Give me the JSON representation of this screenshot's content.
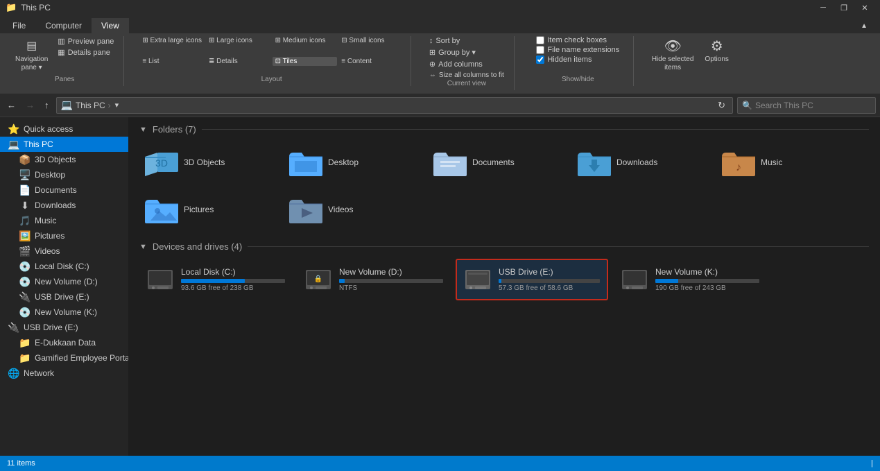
{
  "titlebar": {
    "title": "This PC",
    "minimize": "─",
    "restore": "❐",
    "close": "✕"
  },
  "ribbon": {
    "tabs": [
      "File",
      "Computer",
      "View"
    ],
    "active_tab": "View",
    "groups": {
      "panes": {
        "label": "Panes",
        "buttons": [
          {
            "id": "nav-pane",
            "icon": "▤",
            "label": "Navigation\npane ▾"
          },
          {
            "id": "preview-pane",
            "icon": "▥",
            "label": "Preview pane"
          },
          {
            "id": "details-pane",
            "icon": "▦",
            "label": "Details pane"
          }
        ]
      },
      "layout": {
        "label": "Layout",
        "buttons": [
          {
            "id": "extra-large",
            "label": "Extra large icons"
          },
          {
            "id": "large",
            "label": "Large icons"
          },
          {
            "id": "medium",
            "label": "Medium icons"
          },
          {
            "id": "small",
            "label": "Small icons"
          },
          {
            "id": "list",
            "label": "List"
          },
          {
            "id": "details",
            "label": "Details"
          },
          {
            "id": "tiles",
            "label": "Tiles",
            "active": true
          },
          {
            "id": "content",
            "label": "Content"
          }
        ]
      },
      "current_view": {
        "label": "Current view",
        "buttons": [
          {
            "id": "sort-by",
            "label": "Sort by"
          },
          {
            "id": "group-by",
            "label": "Group by ▾"
          },
          {
            "id": "add-columns",
            "label": "Add columns"
          },
          {
            "id": "size-all",
            "label": "Size all columns to fit"
          }
        ]
      },
      "show_hide": {
        "label": "Show/hide",
        "checkboxes": [
          {
            "id": "item-check",
            "label": "Item check boxes",
            "checked": false
          },
          {
            "id": "file-ext",
            "label": "File name extensions",
            "checked": false
          },
          {
            "id": "hidden",
            "label": "Hidden items",
            "checked": true
          }
        ],
        "buttons": [
          {
            "id": "hide-selected",
            "label": "Hide selected\nitems"
          }
        ]
      },
      "options": {
        "label": "",
        "buttons": [
          {
            "id": "options",
            "label": "Options"
          }
        ]
      }
    }
  },
  "addressbar": {
    "back_disabled": false,
    "forward_disabled": true,
    "up_disabled": false,
    "breadcrumb": "This PC  ›",
    "search_placeholder": "Search This PC"
  },
  "sidebar": {
    "sections": [
      {
        "type": "item",
        "icon": "⭐",
        "label": "Quick access",
        "active": false,
        "indent": 0
      },
      {
        "type": "item",
        "icon": "💻",
        "label": "This PC",
        "active": true,
        "indent": 0
      },
      {
        "type": "item",
        "icon": "📦",
        "label": "3D Objects",
        "active": false,
        "indent": 1
      },
      {
        "type": "item",
        "icon": "🖥️",
        "label": "Desktop",
        "active": false,
        "indent": 1
      },
      {
        "type": "item",
        "icon": "📄",
        "label": "Documents",
        "active": false,
        "indent": 1
      },
      {
        "type": "item",
        "icon": "⬇",
        "label": "Downloads",
        "active": false,
        "indent": 1
      },
      {
        "type": "item",
        "icon": "🎵",
        "label": "Music",
        "active": false,
        "indent": 1
      },
      {
        "type": "item",
        "icon": "🖼️",
        "label": "Pictures",
        "active": false,
        "indent": 1
      },
      {
        "type": "item",
        "icon": "🎬",
        "label": "Videos",
        "active": false,
        "indent": 1
      },
      {
        "type": "item",
        "icon": "💿",
        "label": "Local Disk (C:)",
        "active": false,
        "indent": 1
      },
      {
        "type": "item",
        "icon": "💿",
        "label": "New Volume (D:)",
        "active": false,
        "indent": 1
      },
      {
        "type": "item",
        "icon": "🔌",
        "label": "USB Drive (E:)",
        "active": false,
        "indent": 1
      },
      {
        "type": "item",
        "icon": "💿",
        "label": "New Volume (K:)",
        "active": false,
        "indent": 1
      },
      {
        "type": "item",
        "icon": "🔌",
        "label": "USB Drive (E:)",
        "active": false,
        "indent": 0
      },
      {
        "type": "item",
        "icon": "📁",
        "label": "E-Dukkaan Data",
        "active": false,
        "indent": 1
      },
      {
        "type": "item",
        "icon": "📁",
        "label": "Gamified Employee Portal",
        "active": false,
        "indent": 1
      },
      {
        "type": "item",
        "icon": "🌐",
        "label": "Network",
        "active": false,
        "indent": 0
      }
    ]
  },
  "content": {
    "folders_section": "Folders (7)",
    "folders": [
      {
        "id": "3d-objects",
        "label": "3D Objects",
        "color": "#4a9fd5"
      },
      {
        "id": "desktop",
        "label": "Desktop",
        "color": "#56aeff"
      },
      {
        "id": "documents",
        "label": "Documents",
        "color": "#a8c7e8"
      },
      {
        "id": "downloads",
        "label": "Downloads",
        "color": "#4a9fd5"
      },
      {
        "id": "music",
        "label": "Music",
        "color": "#c8874a"
      },
      {
        "id": "pictures",
        "label": "Pictures",
        "color": "#56aeff"
      },
      {
        "id": "videos",
        "label": "Videos",
        "color": "#7090b0"
      }
    ],
    "drives_section": "Devices and drives (4)",
    "drives": [
      {
        "id": "local-c",
        "label": "Local Disk (C:)",
        "sub": "93.6 GB free of 238 GB",
        "used_pct": 61,
        "bar_color": "blue",
        "selected": false
      },
      {
        "id": "new-d",
        "label": "New Volume (D:)",
        "sub": "NTFS",
        "used_pct": 5,
        "bar_color": "blue",
        "selected": false
      },
      {
        "id": "usb-e",
        "label": "USB Drive (E:)",
        "sub": "57.3 GB free of 58.6 GB",
        "used_pct": 3,
        "bar_color": "blue",
        "selected": true
      },
      {
        "id": "new-k",
        "label": "New Volume (K:)",
        "sub": "190 GB free of 243 GB",
        "used_pct": 22,
        "bar_color": "blue",
        "selected": false
      }
    ]
  },
  "statusbar": {
    "count": "11 items",
    "indicator": "|"
  }
}
